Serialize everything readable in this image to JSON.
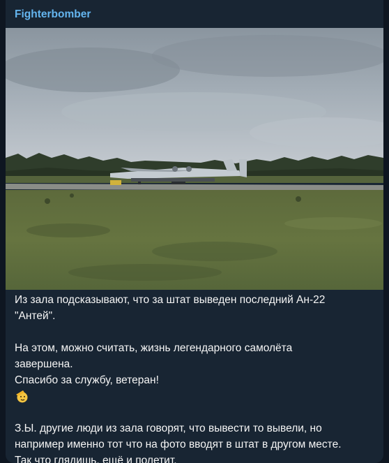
{
  "message": {
    "sender": "Fighterbomber",
    "photo_icon": "an-22-aircraft-photo",
    "lines": [
      "Из зала подсказывают, что за штат выведен последний Ан-22",
      "\"Антей\".",
      "",
      "На этом, можно считать, жизнь легендарного самолёта",
      "завершена.",
      "Спасибо за службу, ветеран!",
      "",
      "",
      "З.Ы. другие люди из зала говорят, что вывести то вывели, но",
      "например именно тот что на фото вводят в штат в другом месте.",
      "Так что глядишь, ещё и полетит."
    ],
    "emoji_icon": "salute-emoji-icon",
    "colors": {
      "background": "#0e1621",
      "bubble": "#182533",
      "sender": "#64b5ef",
      "text": "#f5f5f5"
    }
  }
}
